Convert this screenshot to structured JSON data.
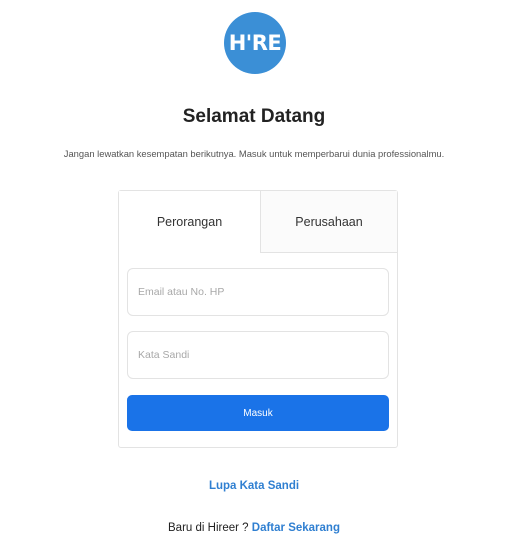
{
  "logo": {
    "text": "H'RE",
    "color": "#3b8fd6"
  },
  "header": {
    "title": "Selamat Datang",
    "subtitle": "Jangan lewatkan kesempatan berikutnya. Masuk untuk memperbarui dunia professionalmu."
  },
  "login": {
    "tabs": [
      {
        "label": "Perorangan",
        "active": true
      },
      {
        "label": "Perusahaan",
        "active": false
      }
    ],
    "email": {
      "placeholder": "Email atau No. HP",
      "value": ""
    },
    "password": {
      "placeholder": "Kata Sandi",
      "value": ""
    },
    "submit_label": "Masuk",
    "submit_color": "#1a73e8"
  },
  "footer": {
    "forgot_label": "Lupa Kata Sandi",
    "register_prefix": "Baru di Hireer ?",
    "register_link": "Daftar Sekarang",
    "link_color": "#2f7fd1"
  }
}
